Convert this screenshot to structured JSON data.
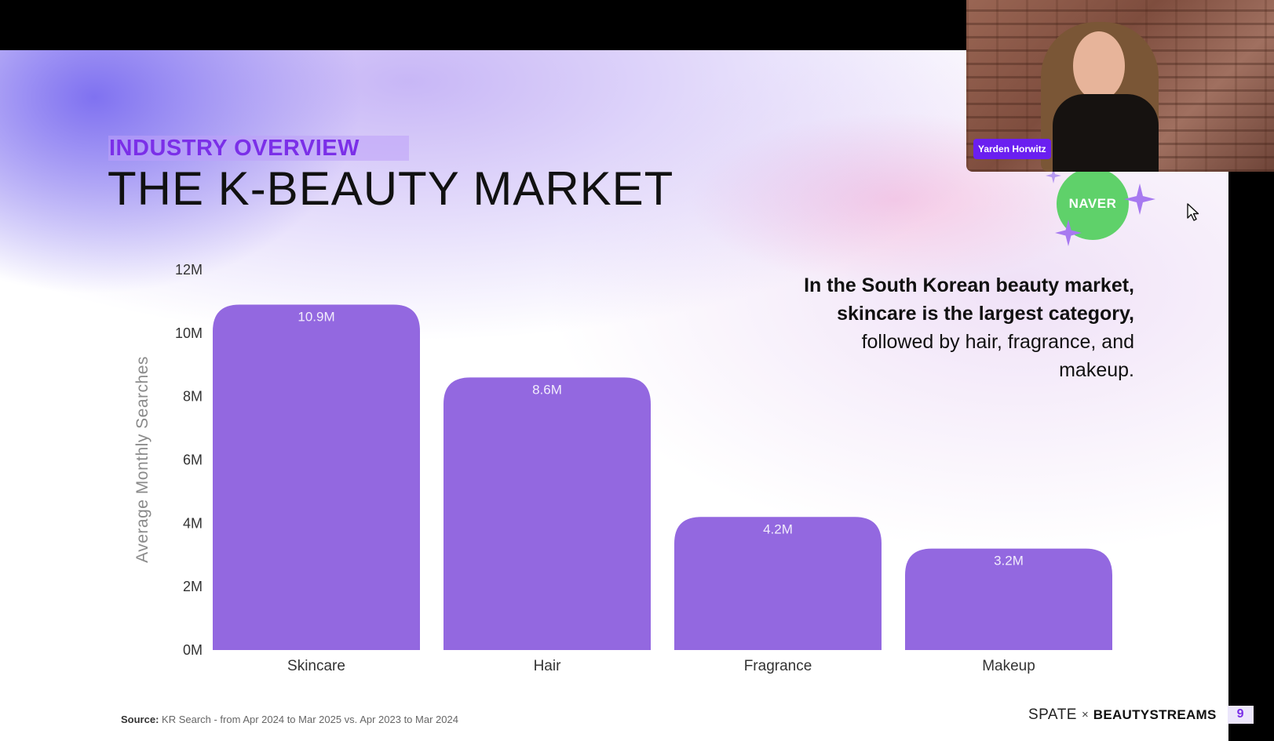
{
  "slide": {
    "eyebrow": "INDUSTRY OVERVIEW",
    "title": "THE K-BEAUTY MARKET",
    "badge": "NAVER",
    "callout": {
      "bold": "In the South Korean beauty market, skincare is the largest category,",
      "regular": " followed by hair, fragrance, and makeup."
    },
    "source_label": "Source:",
    "source_text": " KR Search - from Apr 2024 to Mar 2025 vs. Apr 2023 to Mar 2024",
    "brand_left": "SPATE",
    "brand_x": "×",
    "brand_right": "BEAUTYSTREAMS",
    "page_number": "9"
  },
  "webcam": {
    "participant_name": "Yarden Horwitz"
  },
  "chart_data": {
    "type": "bar",
    "categories": [
      "Skincare",
      "Hair",
      "Fragrance",
      "Makeup"
    ],
    "values": [
      10.9,
      8.6,
      4.2,
      3.2
    ],
    "data_labels": [
      "10.9M",
      "8.6M",
      "4.2M",
      "3.2M"
    ],
    "title": "",
    "xlabel": "",
    "ylabel": "Average Monthly Searches",
    "ylim": [
      0,
      12
    ],
    "y_ticks": [
      "0M",
      "2M",
      "4M",
      "6M",
      "8M",
      "10M",
      "12M"
    ],
    "grid": false,
    "legend": "none"
  },
  "colors": {
    "bar": "#9368e0",
    "eyebrow": "#7b2fe8",
    "badge": "#5fd16a",
    "name_tag": "#6a1ff0",
    "page_box": "#ece6fb"
  }
}
